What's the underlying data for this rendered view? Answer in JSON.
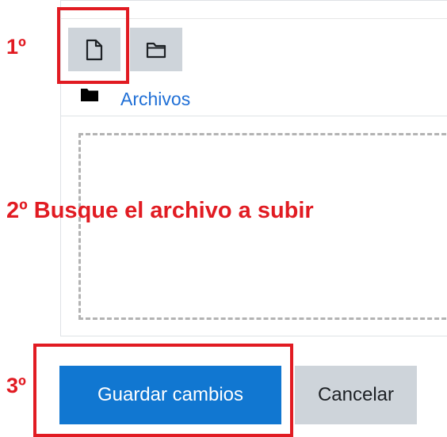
{
  "file_manager": {
    "path_label": "Archivos",
    "icons": {
      "add_file": "file-icon",
      "create_folder": "folder-outline-icon",
      "current_folder": "folder-filled-icon"
    }
  },
  "actions": {
    "save_label": "Guardar cambios",
    "cancel_label": "Cancelar"
  },
  "annotations": {
    "step1": "1º",
    "step2": "2º Busque el archivo a subir",
    "step3": "3º",
    "color": "#e11b22"
  },
  "colors": {
    "primary_button": "#1177d1",
    "secondary_button": "#ced4da",
    "link": "#1f6fd6"
  }
}
